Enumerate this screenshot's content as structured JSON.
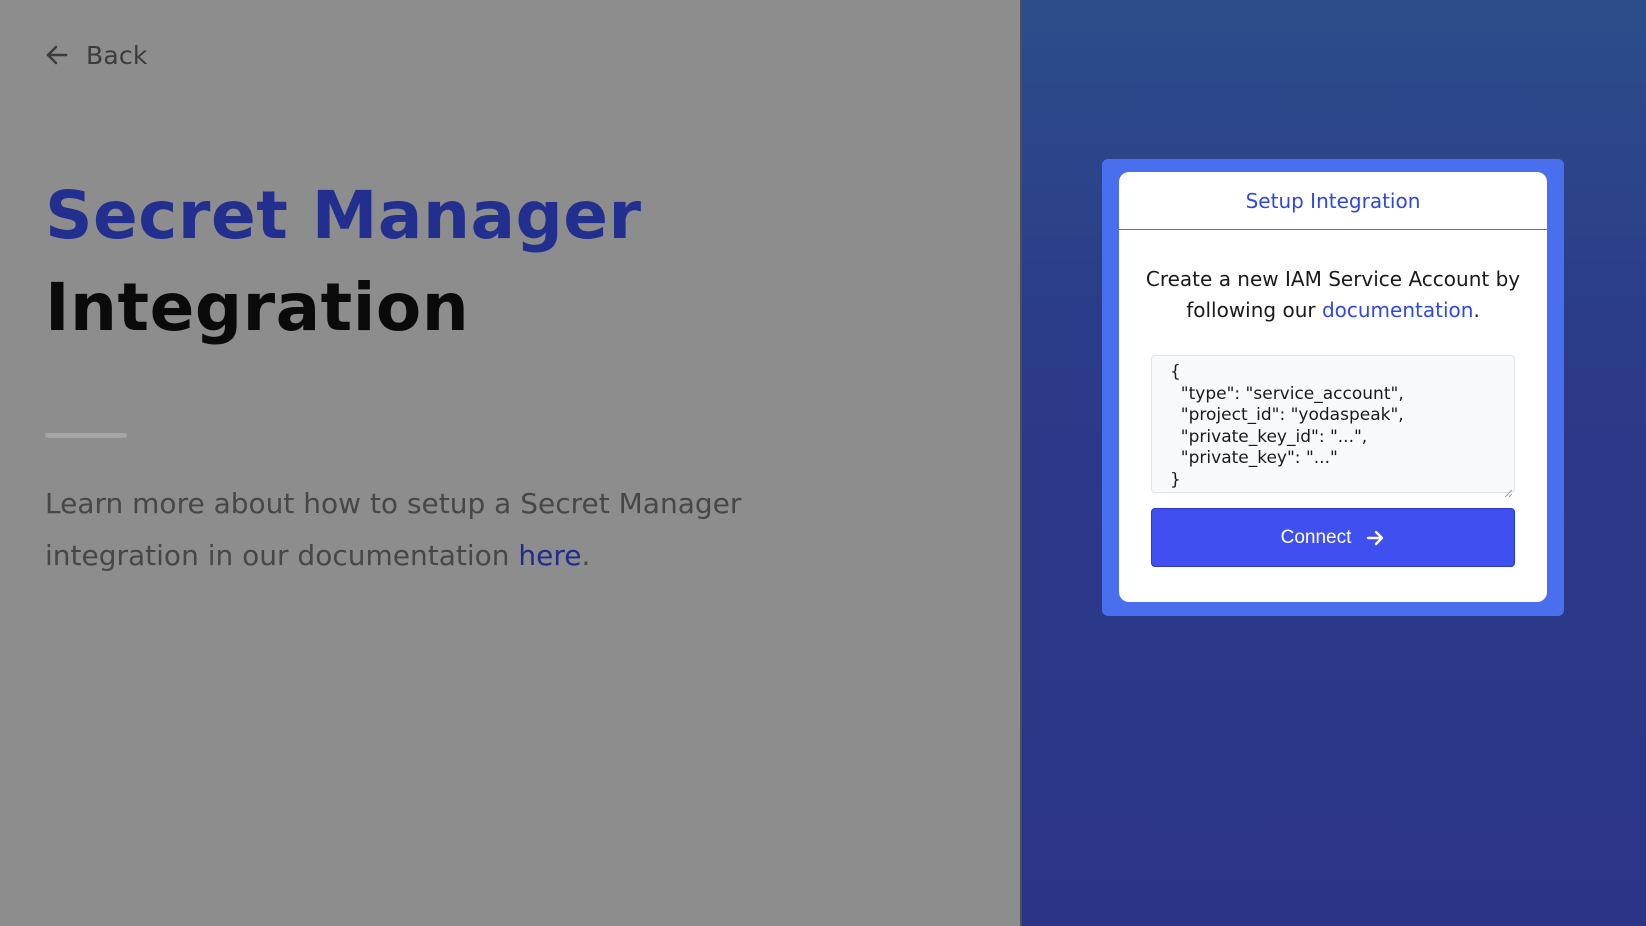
{
  "nav": {
    "back_label": "Back"
  },
  "hero": {
    "title_accent": "Secret Manager",
    "title_main": "Integration",
    "learn_more_text": "Learn more about how to setup a Secret Manager integration in our documentation ",
    "learn_more_link": "here",
    "learn_more_suffix": "."
  },
  "card": {
    "header": "Setup Integration",
    "desc_text": "Create a new IAM Service Account by following our ",
    "desc_link": "documentation",
    "desc_suffix": ".",
    "json_placeholder": "{\n  \"type\": \"service_account\",\n  \"project_id\": \"yodaspeak\",\n  \"private_key_id\": \"...\",\n  \"private_key\": \"...\"\n}",
    "connect_label": "Connect"
  },
  "icons": {
    "back": "arrow-left-icon",
    "connect": "arrow-right-icon"
  },
  "colors": {
    "left_background": "#8d8d8d",
    "title_accent": "#232f8f",
    "link": "#1f2c8d",
    "right_background": "#2c3488",
    "card_border": "#4a6fee",
    "primary_button": "#3f4ff0"
  }
}
